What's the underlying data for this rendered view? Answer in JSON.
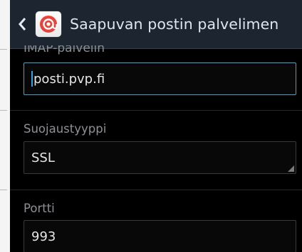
{
  "header": {
    "title": "Saapuvan postin palvelimen"
  },
  "imap": {
    "label": "IMAP-palvelin",
    "value": "posti.pvp.fi"
  },
  "security": {
    "label": "Suojaustyyppi",
    "value": "SSL"
  },
  "port": {
    "label": "Portti",
    "value": "993"
  },
  "colors": {
    "action_bar": "#1d2630",
    "accent": "#2fa6e4",
    "background": "#000000"
  },
  "icons": {
    "back": "back-chevron-icon",
    "app": "email-app-icon"
  }
}
